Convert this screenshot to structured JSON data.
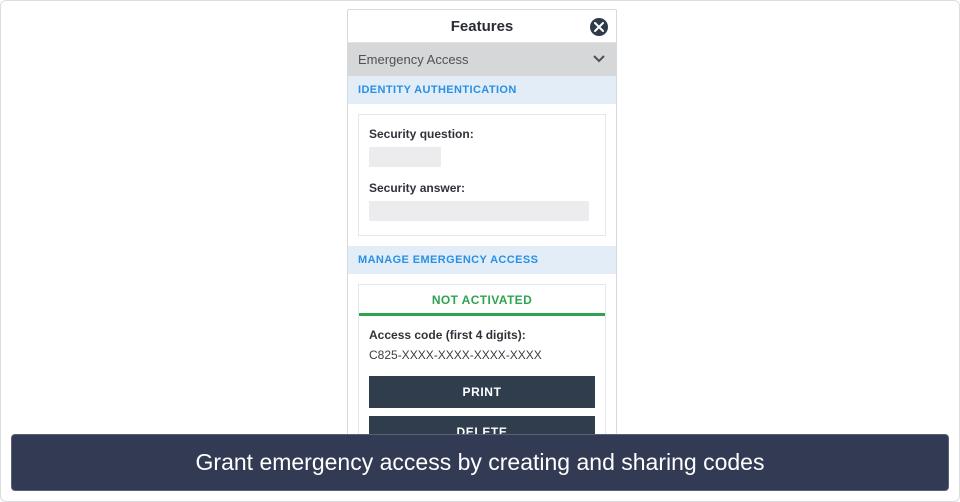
{
  "header": {
    "title": "Features"
  },
  "dropdown": {
    "selected": "Emergency Access"
  },
  "sections": {
    "identity_auth": {
      "label": "IDENTITY AUTHENTICATION",
      "security_question_label": "Security question:",
      "security_answer_label": "Security answer:"
    },
    "manage": {
      "label": "MANAGE EMERGENCY ACCESS",
      "status": "NOT ACTIVATED",
      "code_label": "Access code (first 4 digits):",
      "code_value": "C825-XXXX-XXXX-XXXX-XXXX",
      "print_label": "PRINT",
      "delete_label": "DELETE"
    }
  },
  "caption": "Grant emergency access by creating and sharing codes"
}
